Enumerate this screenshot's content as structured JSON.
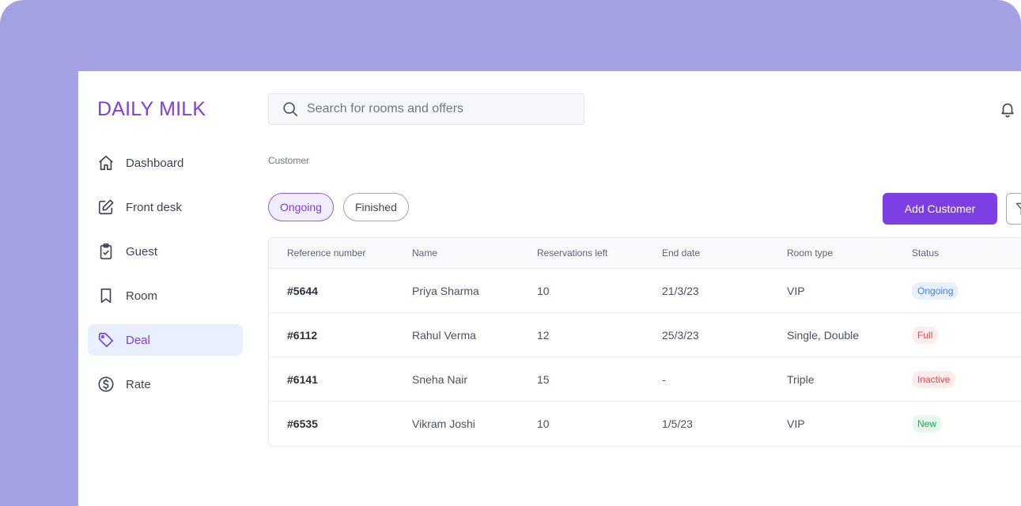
{
  "brand": "DAILY MILK",
  "colors": {
    "accent": "#7b3fe4",
    "frame": "#a4a2e2"
  },
  "nav": [
    {
      "label": "Dashboard",
      "icon": "home-icon",
      "active": false
    },
    {
      "label": "Front desk",
      "icon": "edit-icon",
      "active": false
    },
    {
      "label": "Guest",
      "icon": "clipboard-check-icon",
      "active": false
    },
    {
      "label": "Room",
      "icon": "bookmark-icon",
      "active": false
    },
    {
      "label": "Deal",
      "icon": "tag-icon",
      "active": true
    },
    {
      "label": "Rate",
      "icon": "dollar-circle-icon",
      "active": false
    }
  ],
  "search": {
    "placeholder": "Search for rooms and offers",
    "value": ""
  },
  "breadcrumb": "Customer",
  "tabs": [
    {
      "label": "Ongoing",
      "active": true
    },
    {
      "label": "Finished",
      "active": false
    }
  ],
  "add_button": "Add Customer",
  "table": {
    "headers": [
      "Reference number",
      "Name",
      "Reservations left",
      "End date",
      "Room type",
      "Status"
    ],
    "rows": [
      {
        "ref": "#5644",
        "name": "Priya Sharma",
        "reservations": "10",
        "end_date": "21/3/23",
        "room_type": "VIP",
        "status": "Ongoing",
        "status_color": "#3b82f6",
        "status_bg": "#e8f0fd"
      },
      {
        "ref": "#6112",
        "name": "Rahul Verma",
        "reservations": "12",
        "end_date": "25/3/23",
        "room_type": "Single, Double",
        "status": "Full",
        "status_color": "#ef4444",
        "status_bg": "#fdecec"
      },
      {
        "ref": "#6141",
        "name": "Sneha Nair",
        "reservations": "15",
        "end_date": "-",
        "room_type": "Triple",
        "status": "Inactive",
        "status_color": "#ef4444",
        "status_bg": "#fdecec"
      },
      {
        "ref": "#6535",
        "name": "Vikram Joshi",
        "reservations": "10",
        "end_date": "1/5/23",
        "room_type": "VIP",
        "status": "New",
        "status_color": "#22a55a",
        "status_bg": "#e6f7ed"
      }
    ]
  }
}
